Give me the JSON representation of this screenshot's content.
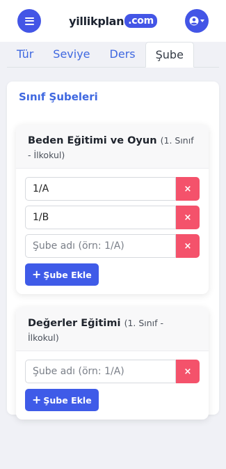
{
  "header": {
    "logo_text": "yillikplan",
    "logo_suffix": ".com"
  },
  "tabs": [
    {
      "label": "Tür",
      "active": false
    },
    {
      "label": "Seviye",
      "active": false
    },
    {
      "label": "Ders",
      "active": false
    },
    {
      "label": "Şube",
      "active": true
    }
  ],
  "main": {
    "title": "Sınıf Şubeleri",
    "sections": [
      {
        "name": "Beden Eğitimi ve Oyun",
        "sub": "(1. Sınıf - İlkokul)",
        "rows": [
          {
            "value": "1/A",
            "placeholder": ""
          },
          {
            "value": "1/B",
            "placeholder": ""
          },
          {
            "value": "",
            "placeholder": "Şube adı (örn: 1/A)"
          }
        ],
        "delete_icon": "×",
        "add_label": "Şube Ekle"
      },
      {
        "name": "Değerler Eğitimi",
        "sub": "(1. Sınıf - İlkokul)",
        "rows": [
          {
            "value": "",
            "placeholder": "Şube adı (örn: 1/A)"
          }
        ],
        "delete_icon": "×",
        "add_label": "Şube Ekle"
      }
    ]
  },
  "colors": {
    "accent": "#4355e6",
    "link": "#3f68e0",
    "danger": "#f4526b",
    "page_bg": "#f0f1f6"
  },
  "icons": {
    "menu": "hamburger-menu-icon",
    "user": "user-circle-icon",
    "caret": "caret-down-icon",
    "delete": "close-icon",
    "add": "plus-icon"
  }
}
